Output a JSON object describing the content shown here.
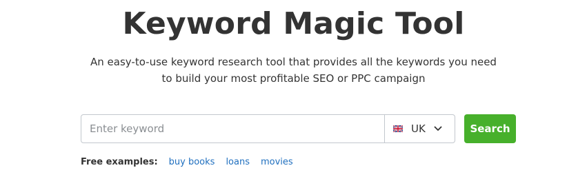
{
  "header": {
    "title": "Keyword Magic Tool",
    "subtitle_line1": "An easy-to-use keyword research tool that provides all the keywords you need",
    "subtitle_line2": "to build your most profitable SEO or PPC campaign"
  },
  "search": {
    "placeholder": "Enter keyword",
    "value": "",
    "database": {
      "label": "UK",
      "flag_icon": "uk-flag-icon",
      "dropdown_icon": "chevron-down-icon"
    },
    "button_label": "Search",
    "button_color": "#47b02b"
  },
  "examples": {
    "label": "Free examples:",
    "items": [
      "buy books",
      "loans",
      "movies"
    ],
    "link_color": "#1f6fbf"
  }
}
